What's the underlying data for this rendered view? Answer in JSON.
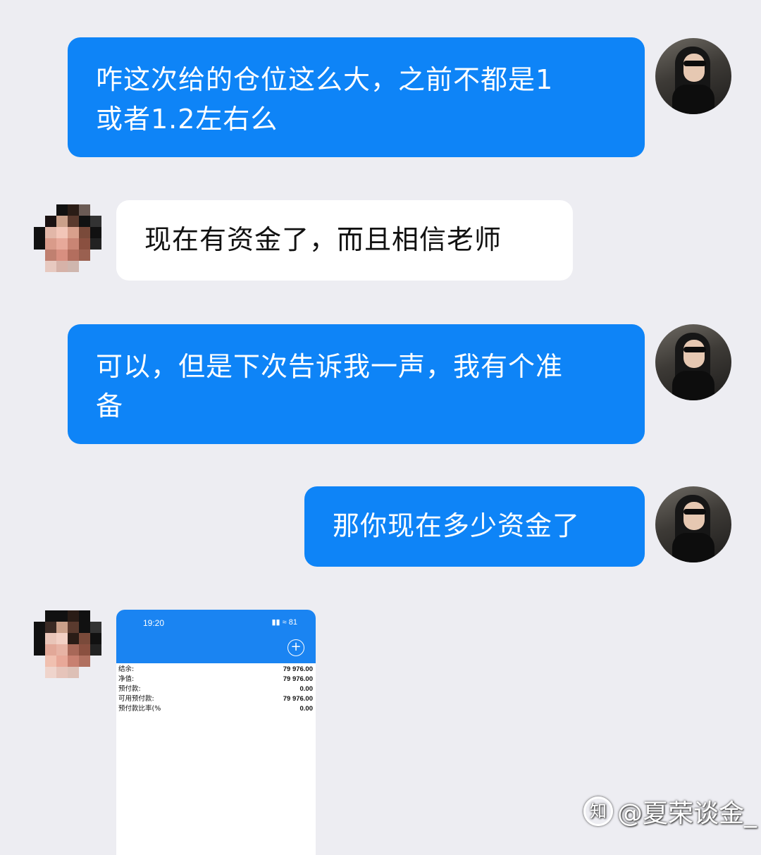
{
  "messages": [
    {
      "side": "right",
      "text": "咋这次给的仓位这么大，之前不都是1\n或者1.2左右么"
    },
    {
      "side": "left",
      "text": "现在有资金了，而且相信老师"
    },
    {
      "side": "right",
      "text": "可以，但是下次告诉我一声，我有个准\n备"
    },
    {
      "side": "right",
      "text": "那你现在多少资金了"
    }
  ],
  "screenshot": {
    "time": "19:20",
    "status": "▮▮ ≈ 81",
    "rows": [
      {
        "label": "结余:",
        "value": "79 976.00"
      },
      {
        "label": "净值:",
        "value": "79 976.00"
      },
      {
        "label": "预付款:",
        "value": "0.00"
      },
      {
        "label": "可用预付款:",
        "value": "79 976.00"
      },
      {
        "label": "预付款比率(%",
        "value": "0.00"
      }
    ]
  },
  "watermark": {
    "logo": "知",
    "text": "@夏荣谈金_"
  },
  "colors": {
    "bubble_blue": "#0e84f7",
    "background": "#ededf2"
  }
}
